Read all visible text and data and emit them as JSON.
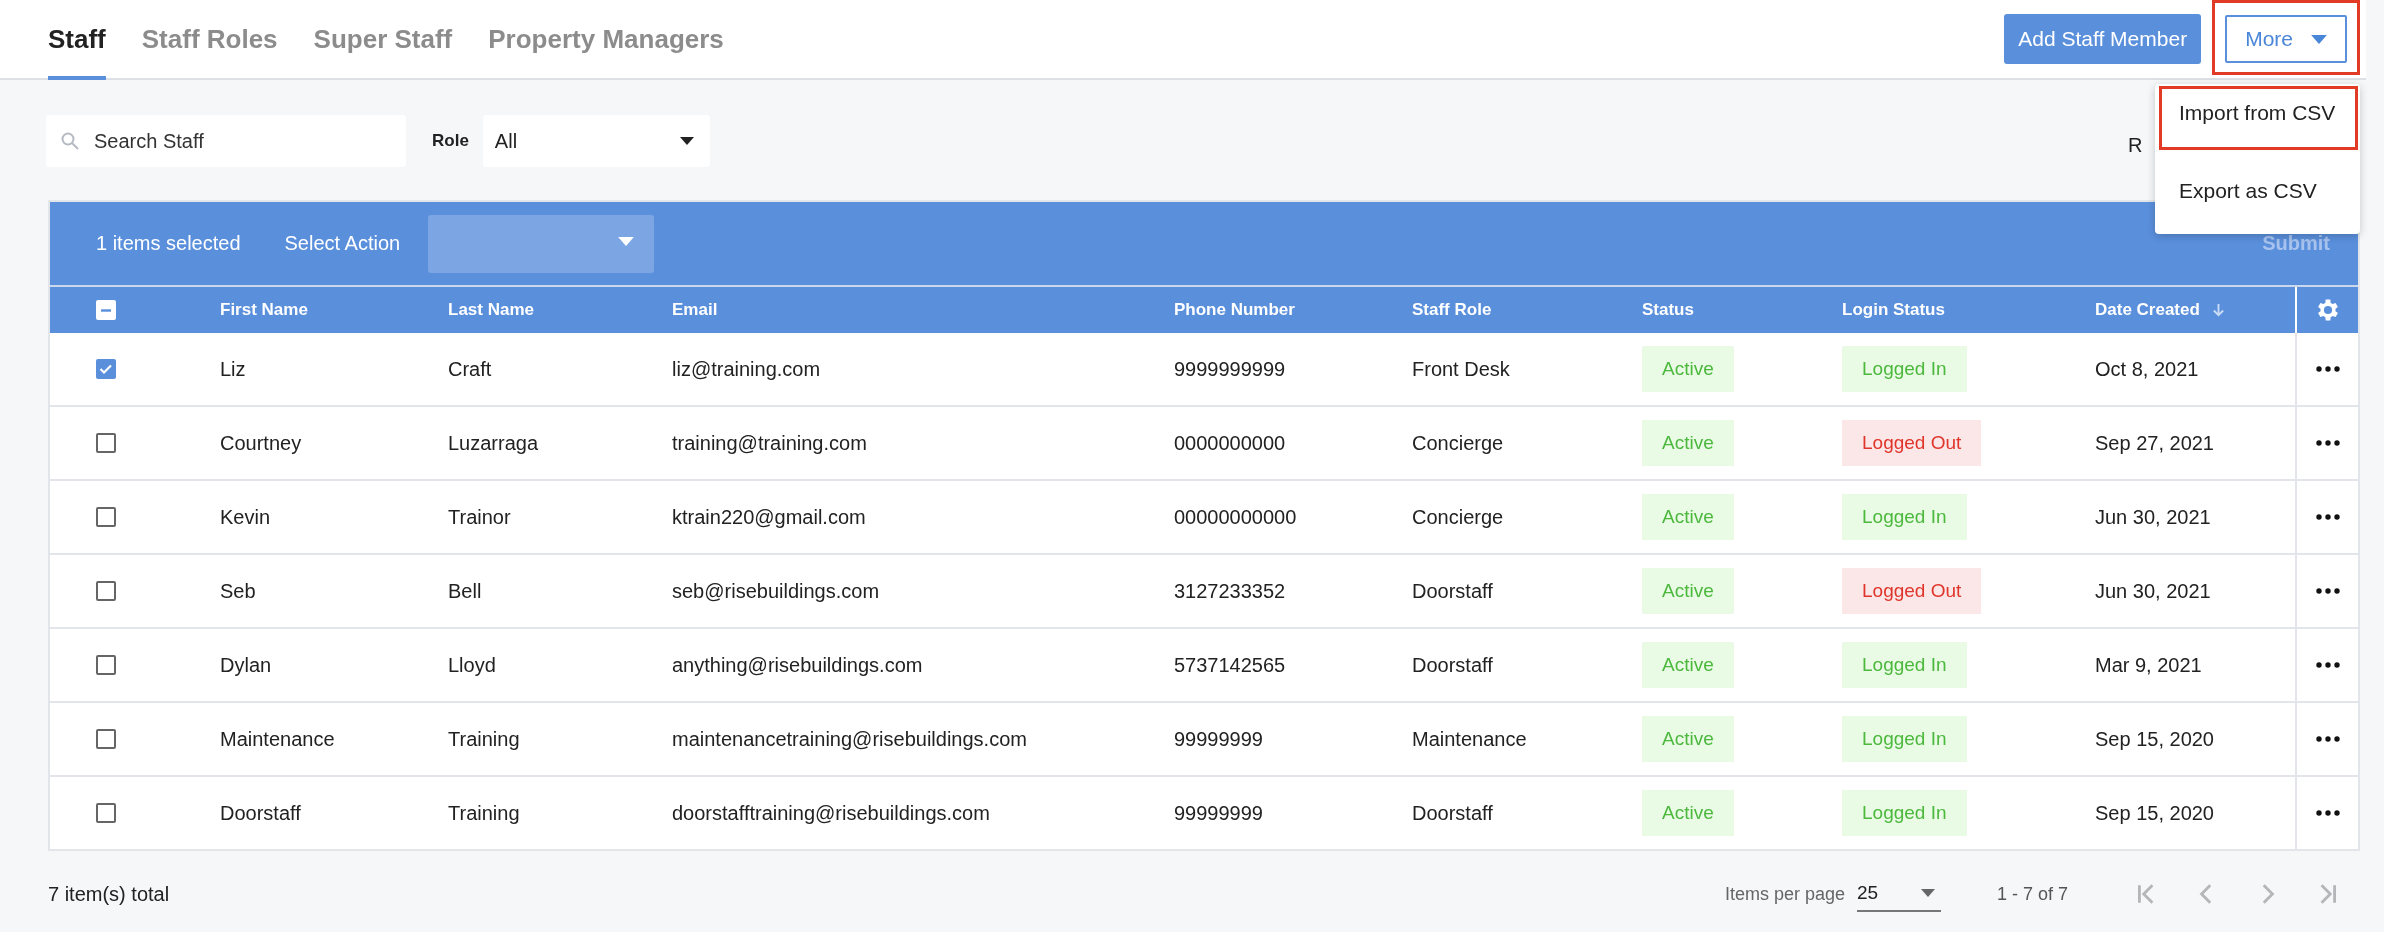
{
  "tabs": [
    {
      "label": "Staff",
      "selected": true
    },
    {
      "label": "Staff Roles",
      "selected": false
    },
    {
      "label": "Super Staff",
      "selected": false
    },
    {
      "label": "Property Managers",
      "selected": false
    }
  ],
  "header_buttons": {
    "add": {
      "label": "Add Staff Member"
    },
    "more": {
      "label": "More",
      "highlighted": true
    }
  },
  "more_menu": [
    {
      "label": "Import from CSV",
      "highlighted": true
    },
    {
      "label": "Export as CSV",
      "highlighted": false
    }
  ],
  "filters": {
    "search": {
      "placeholder": "Search Staff"
    },
    "role_label": "Role",
    "role_value": "All",
    "partial_label": "R"
  },
  "action_bar": {
    "selected_count": "1 items selected",
    "action_label": "Select Action",
    "submit": {
      "label": "Submit",
      "disabled": true
    }
  },
  "table": {
    "header_partly_checked": true,
    "columns": [
      {
        "label": "First Name"
      },
      {
        "label": "Last Name"
      },
      {
        "label": "Email"
      },
      {
        "label": "Phone Number"
      },
      {
        "label": "Staff Role"
      },
      {
        "label": "Status"
      },
      {
        "label": "Login Status"
      },
      {
        "label": "Date Created",
        "sorted_descending": true
      }
    ],
    "rows": [
      {
        "checked": true,
        "cells": [
          "Liz",
          "Craft",
          "liz@training.com",
          "9999999999",
          "Front Desk"
        ],
        "status": {
          "text": "Active",
          "active": true
        },
        "login": {
          "text": "Logged In",
          "logged_in": true
        },
        "date": "Oct 8, 2021"
      },
      {
        "checked": false,
        "cells": [
          "Courtney",
          "Luzarraga",
          "training@training.com",
          "0000000000",
          "Concierge"
        ],
        "status": {
          "text": "Active",
          "active": true
        },
        "login": {
          "text": "Logged Out",
          "logged_in": false
        },
        "date": "Sep 27, 2021"
      },
      {
        "checked": false,
        "cells": [
          "Kevin",
          "Trainor",
          "ktrain220@gmail.com",
          "00000000000",
          "Concierge"
        ],
        "status": {
          "text": "Active",
          "active": true
        },
        "login": {
          "text": "Logged In",
          "logged_in": true
        },
        "date": "Jun 30, 2021"
      },
      {
        "checked": false,
        "cells": [
          "Seb",
          "Bell",
          "seb@risebuildings.com",
          "3127233352",
          "Doorstaff"
        ],
        "status": {
          "text": "Active",
          "active": true
        },
        "login": {
          "text": "Logged Out",
          "logged_in": false
        },
        "date": "Jun 30, 2021"
      },
      {
        "checked": false,
        "cells": [
          "Dylan",
          "Lloyd",
          "anything@risebuildings.com",
          "5737142565",
          "Doorstaff"
        ],
        "status": {
          "text": "Active",
          "active": true
        },
        "login": {
          "text": "Logged In",
          "logged_in": true
        },
        "date": "Mar 9, 2021"
      },
      {
        "checked": false,
        "cells": [
          "Maintenance",
          "Training",
          "maintenancetraining@risebuildings.com",
          "99999999",
          "Maintenance"
        ],
        "status": {
          "text": "Active",
          "active": true
        },
        "login": {
          "text": "Logged In",
          "logged_in": true
        },
        "date": "Sep 15, 2020"
      },
      {
        "checked": false,
        "cells": [
          "Doorstaff",
          "Training",
          "doorstafftraining@risebuildings.com",
          "99999999",
          "Doorstaff"
        ],
        "status": {
          "text": "Active",
          "active": true
        },
        "login": {
          "text": "Logged In",
          "logged_in": true
        },
        "date": "Sep 15, 2020"
      }
    ]
  },
  "footer": {
    "total": "7 item(s) total",
    "per_page_label": "Items per page",
    "per_page": "25",
    "range": "1 - 7 of 7",
    "nav": [
      {
        "kind": "first",
        "disabled": true
      },
      {
        "kind": "prev",
        "disabled": true
      },
      {
        "kind": "next",
        "disabled": true
      },
      {
        "kind": "last",
        "disabled": true
      }
    ]
  }
}
